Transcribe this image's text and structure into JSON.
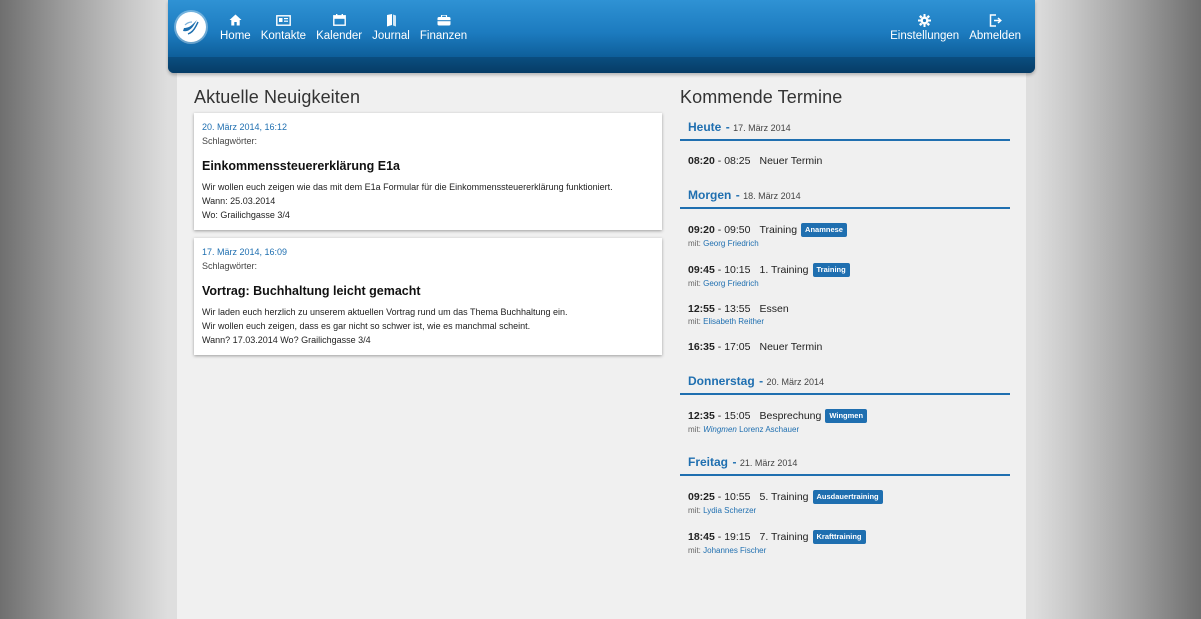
{
  "nav": {
    "left": [
      {
        "label": "Home",
        "icon": "home-icon"
      },
      {
        "label": "Kontakte",
        "icon": "contacts-icon"
      },
      {
        "label": "Kalender",
        "icon": "calendar-icon"
      },
      {
        "label": "Journal",
        "icon": "journal-icon"
      },
      {
        "label": "Finanzen",
        "icon": "finance-icon"
      }
    ],
    "right": [
      {
        "label": "Einstellungen",
        "icon": "gear-icon"
      },
      {
        "label": "Abmelden",
        "icon": "logout-icon"
      }
    ]
  },
  "news": {
    "title": "Aktuelle Neuigkeiten",
    "items": [
      {
        "date": "20. März 2014, 16:12",
        "tags": "Schlagwörter:",
        "title": "Einkommenssteuererklärung E1a",
        "lines": [
          "Wir wollen euch zeigen wie das mit dem E1a Formular für die Einkommenssteuererklärung funktioniert.",
          "Wann: 25.03.2014",
          "Wo: Grailichgasse 3/4"
        ]
      },
      {
        "date": "17. März 2014, 16:09",
        "tags": "Schlagwörter:",
        "title": "Vortrag: Buchhaltung leicht gemacht",
        "lines": [
          "Wir laden euch herzlich zu unserem aktuellen Vortrag rund um das Thema Buchhaltung ein.",
          "Wir wollen euch zeigen, dass es gar nicht so schwer ist, wie es manchmal scheint.",
          "Wann? 17.03.2014 Wo? Grailichgasse 3/4"
        ]
      }
    ]
  },
  "events": {
    "title": "Kommende Termine",
    "days": [
      {
        "name": "Heute",
        "date": "17. März 2014",
        "events": [
          {
            "start": "08:20",
            "end": "08:25",
            "title": "Neuer Termin",
            "badge": "",
            "with_prefix": "",
            "company": "",
            "person": ""
          }
        ]
      },
      {
        "name": "Morgen",
        "date": "18. März 2014",
        "events": [
          {
            "start": "09:20",
            "end": "09:50",
            "title": "Training",
            "badge": "Anamnese",
            "with_prefix": "mit:",
            "company": "",
            "person": "Georg Friedrich"
          },
          {
            "start": "09:45",
            "end": "10:15",
            "title": "1. Training",
            "badge": "Training",
            "with_prefix": "mit:",
            "company": "",
            "person": "Georg Friedrich"
          },
          {
            "start": "12:55",
            "end": "13:55",
            "title": "Essen",
            "badge": "",
            "with_prefix": "mit:",
            "company": "",
            "person": "Elisabeth Reither"
          },
          {
            "start": "16:35",
            "end": "17:05",
            "title": "Neuer Termin",
            "badge": "",
            "with_prefix": "",
            "company": "",
            "person": ""
          }
        ]
      },
      {
        "name": "Donnerstag",
        "date": "20. März 2014",
        "events": [
          {
            "start": "12:35",
            "end": "15:05",
            "title": "Besprechung",
            "badge": "Wingmen",
            "with_prefix": "mit:",
            "company": "Wingmen",
            "person": "Lorenz Aschauer"
          }
        ]
      },
      {
        "name": "Freitag",
        "date": "21. März 2014",
        "events": [
          {
            "start": "09:25",
            "end": "10:55",
            "title": "5. Training",
            "badge": "Ausdauertraining",
            "with_prefix": "mit:",
            "company": "",
            "person": "Lydia Scherzer"
          },
          {
            "start": "18:45",
            "end": "19:15",
            "title": "7. Training",
            "badge": "Krafttraining",
            "with_prefix": "mit:",
            "company": "",
            "person": "Johannes Fischer"
          }
        ]
      }
    ]
  },
  "colors": {
    "accent": "#1f6fb0",
    "nav_top": "#2f92d4",
    "nav_bottom": "#0a4f84",
    "panel_bg": "#f0f0f0"
  }
}
